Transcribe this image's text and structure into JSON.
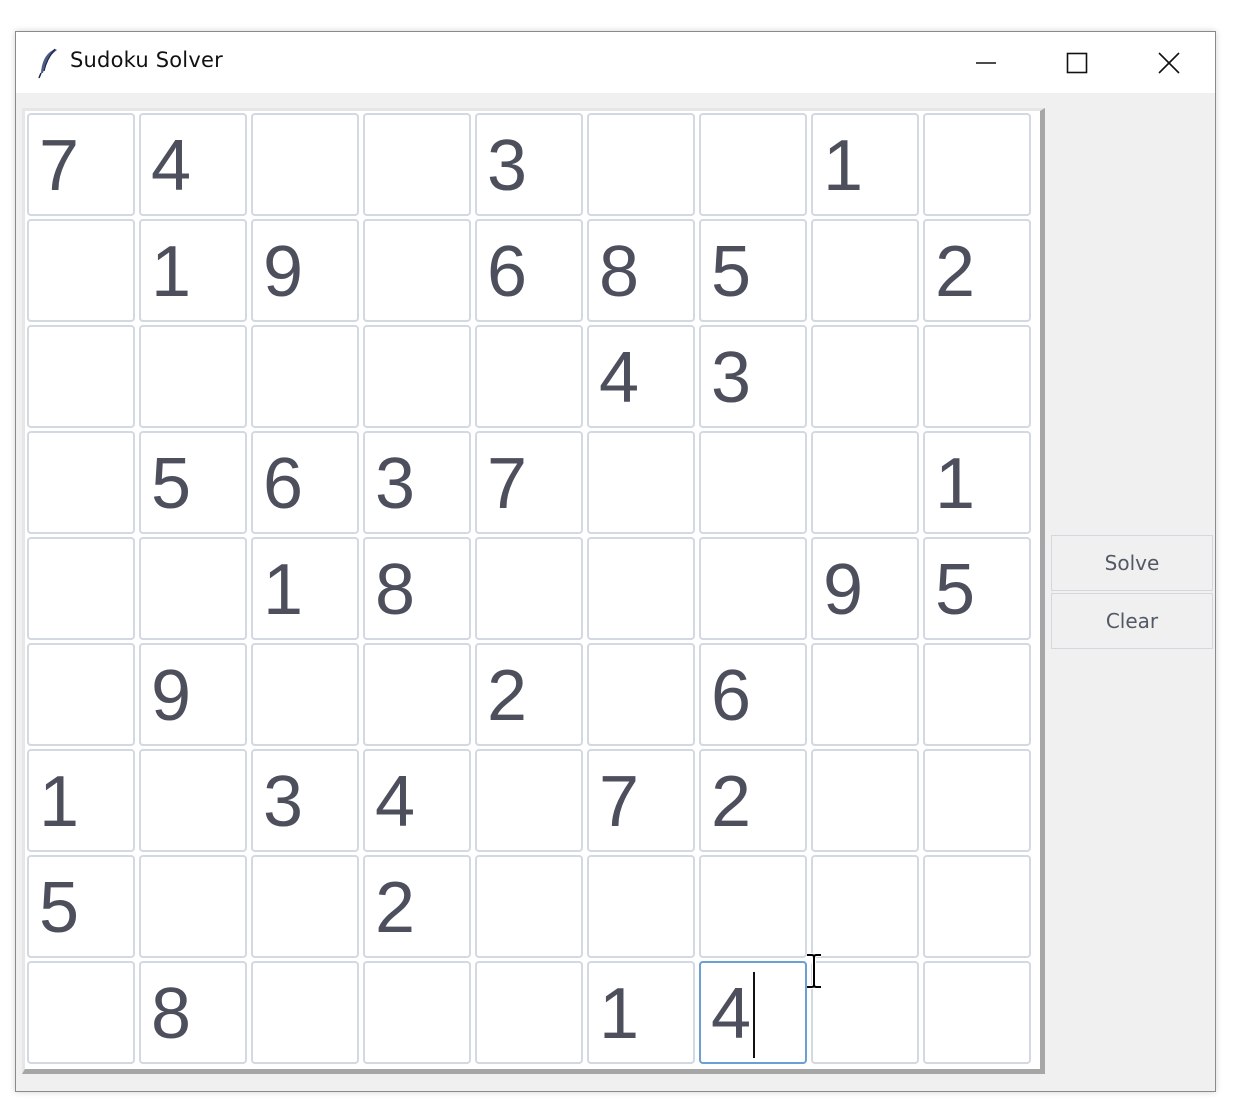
{
  "window": {
    "title": "Sudoku Solver",
    "app_icon": "feather-icon",
    "controls": {
      "minimize_icon": "minimize-icon",
      "maximize_icon": "maximize-icon",
      "close_icon": "close-icon"
    }
  },
  "board": {
    "rows": [
      [
        "7",
        "4",
        "",
        "",
        "3",
        "",
        "",
        "1",
        ""
      ],
      [
        "",
        "1",
        "9",
        "",
        "6",
        "8",
        "5",
        "",
        "2"
      ],
      [
        "",
        "",
        "",
        "",
        "",
        "4",
        "3",
        "",
        ""
      ],
      [
        "",
        "5",
        "6",
        "3",
        "7",
        "",
        "",
        "",
        "1"
      ],
      [
        "",
        "",
        "1",
        "8",
        "",
        "",
        "",
        "9",
        "5"
      ],
      [
        "",
        "9",
        "",
        "",
        "2",
        "",
        "6",
        "",
        ""
      ],
      [
        "1",
        "",
        "3",
        "4",
        "",
        "7",
        "2",
        "",
        ""
      ],
      [
        "5",
        "",
        "",
        "2",
        "",
        "",
        "",
        "",
        ""
      ],
      [
        "",
        "8",
        "",
        "",
        "",
        "1",
        "4",
        "",
        ""
      ]
    ],
    "focused_cell": {
      "row": 8,
      "col": 6
    }
  },
  "buttons": {
    "solve_label": "Solve",
    "clear_label": "Clear"
  },
  "colors": {
    "digit": "#4d505c",
    "cell_border": "#d3d9e3",
    "focus_border": "#6c9fd4"
  },
  "cursor": "text-ibeam-cursor"
}
